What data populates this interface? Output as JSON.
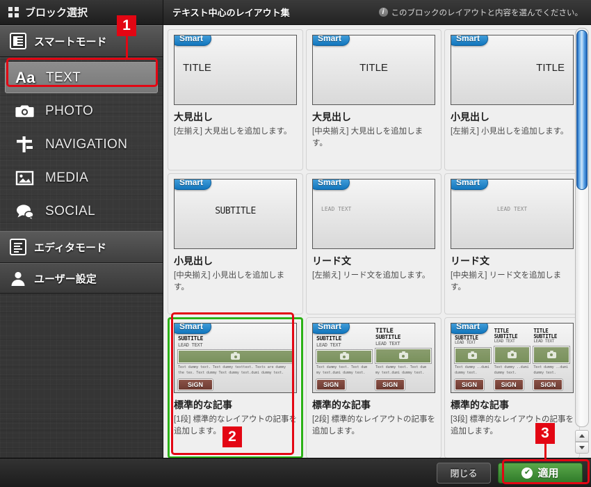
{
  "sidebar": {
    "header": {
      "title": "ブロック選択",
      "icon": "grid-icon"
    },
    "mode_smart": {
      "label": "スマートモード",
      "icon": "smart-mode-icon"
    },
    "categories": [
      {
        "label": "TEXT",
        "icon": "aa-text-icon",
        "selected": true
      },
      {
        "label": "PHOTO",
        "icon": "camera-icon",
        "selected": false
      },
      {
        "label": "NAVIGATION",
        "icon": "navigation-icon",
        "selected": false
      },
      {
        "label": "MEDIA",
        "icon": "media-image-icon",
        "selected": false
      },
      {
        "label": "SOCIAL",
        "icon": "speech-bubble-icon",
        "selected": false
      }
    ],
    "mode_editor": {
      "label": "エディタモード",
      "icon": "editor-mode-icon"
    },
    "user_settings": {
      "label": "ユーザー設定",
      "icon": "user-icon"
    }
  },
  "main": {
    "title": "テキスト中心のレイアウト集",
    "hint": "このブロックのレイアウトと内容を選んでください。",
    "hint_icon": "info-icon",
    "smart_badge": "Smart",
    "cards": [
      {
        "badge": "Smart",
        "preview_text": "TITLE",
        "preview_align": "tleft",
        "preview_style": "",
        "name": "大見出し",
        "desc": "[左揃え] 大見出しを追加します。",
        "selected": false,
        "type": "heading"
      },
      {
        "badge": "Smart",
        "preview_text": "TITLE",
        "preview_align": "tcenter",
        "preview_style": "",
        "name": "大見出し",
        "desc": "[中央揃え] 大見出しを追加します。",
        "selected": false,
        "type": "heading"
      },
      {
        "badge": "Smart",
        "preview_text": "TITLE",
        "preview_align": "tright",
        "preview_style": "",
        "name": "小見出し",
        "desc": "[左揃え] 小見出しを追加します。",
        "selected": false,
        "type": "heading"
      },
      {
        "badge": "Smart",
        "preview_text": "SUBTITLE",
        "preview_align": "tcenter",
        "preview_style": "small",
        "name": "小見出し",
        "desc": "[中央揃え] 小見出しを追加します。",
        "selected": false,
        "type": "heading"
      },
      {
        "badge": "Smart",
        "preview_text": "LEAD TEXT",
        "preview_align": "tleft",
        "preview_style": "lead",
        "name": "リード文",
        "desc": "[左揃え] リード文を追加します。",
        "selected": false,
        "type": "heading"
      },
      {
        "badge": "Smart",
        "preview_text": "LEAD TEXT",
        "preview_align": "tcenter",
        "preview_style": "lead",
        "name": "リード文",
        "desc": "[中央揃え] リード文を追加します。",
        "selected": false,
        "type": "heading"
      },
      {
        "badge": "Smart",
        "columns": 1,
        "name": "標準的な記事",
        "desc": "[1段] 標準的なレイアウトの記事を追加します。",
        "selected": true,
        "type": "article"
      },
      {
        "badge": "Smart",
        "columns": 2,
        "name": "標準的な記事",
        "desc": "[2段] 標準的なレイアウトの記事を追加します。",
        "selected": false,
        "type": "article"
      },
      {
        "badge": "Smart",
        "columns": 3,
        "name": "標準的な記事",
        "desc": "[3段] 標準的なレイアウトの記事を追加します。",
        "selected": false,
        "type": "article"
      }
    ],
    "article_parts": {
      "title": "TITLE",
      "subtitle": "SUBTITLE",
      "lead": "LEAD TEXT",
      "sign": "SiGN",
      "body_1col": "Text dummy text. Text dummy texttext. Texts are dummy the tex. Text dummy Text dummy text.dumi dummy text.",
      "body_2col": "Text dummy text. Text dum my text.dumi dummy text.",
      "body_3col": "Text dummy ..dumi dummy text.",
      "photo_icon": "camera-icon"
    }
  },
  "footer": {
    "close_label": "閉じる",
    "apply_label": "適用",
    "apply_icon": "check-circle-icon"
  },
  "annotations": {
    "step1": "1",
    "step2": "2",
    "step3": "3"
  },
  "colors": {
    "accent_red": "#e30613",
    "apply_green": "#2f7a29",
    "selected_green": "#2cb117",
    "smart_blue": "#1276bd",
    "scrollbar_blue": "#1c5fb4"
  }
}
